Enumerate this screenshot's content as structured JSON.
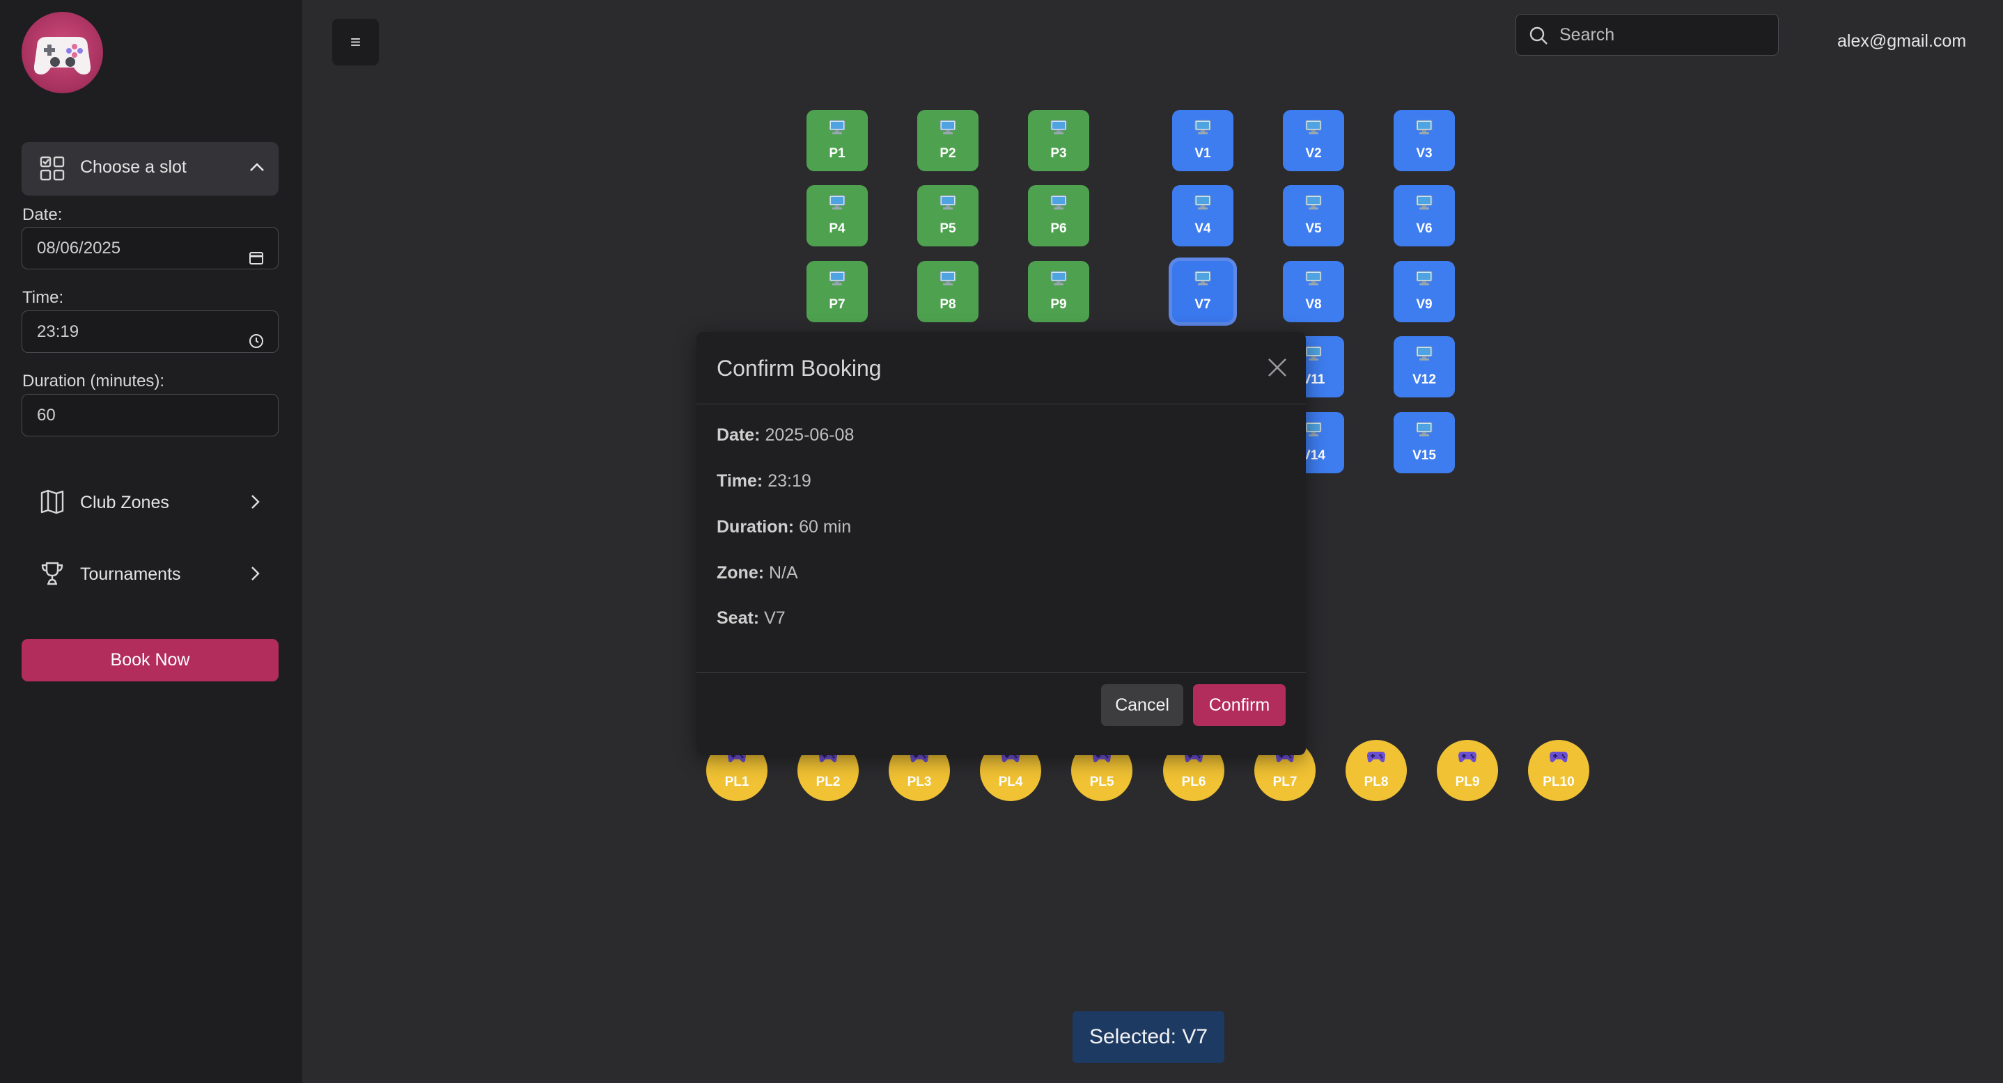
{
  "sidebar": {
    "slot_section": {
      "label": "Choose a slot"
    },
    "date": {
      "label": "Date:",
      "value": "08/06/2025"
    },
    "time": {
      "label": "Time:",
      "value": "23:19"
    },
    "duration": {
      "label": "Duration (minutes):",
      "value": "60"
    },
    "nav": [
      {
        "label": "Club Zones",
        "icon": "map-icon"
      },
      {
        "label": "Tournaments",
        "icon": "trophy-icon"
      }
    ],
    "book_button": "Book Now"
  },
  "topbar": {
    "menu_icon": "≡",
    "search_placeholder": "Search",
    "user_email": "alex@gmail.com"
  },
  "seats": {
    "green": [
      "P1",
      "P2",
      "P3",
      "P4",
      "P5",
      "P6",
      "P7",
      "P8",
      "P9"
    ],
    "blue": [
      "V1",
      "V2",
      "V3",
      "V4",
      "V5",
      "V6",
      "V7",
      "V8",
      "V9",
      "V11",
      "V12",
      "V14",
      "V15"
    ],
    "consoles": [
      "PL1",
      "PL2",
      "PL3",
      "PL4",
      "PL5",
      "PL6",
      "PL7",
      "PL8",
      "PL9",
      "PL10"
    ],
    "selected": "V7"
  },
  "modal": {
    "title": "Confirm Booking",
    "rows": [
      {
        "key": "Date:",
        "value": "2025-06-08"
      },
      {
        "key": "Time:",
        "value": "23:19"
      },
      {
        "key": "Duration:",
        "value": "60 min"
      },
      {
        "key": "Zone:",
        "value": "N/A"
      },
      {
        "key": "Seat:",
        "value": "V7"
      }
    ],
    "cancel": "Cancel",
    "confirm": "Confirm"
  },
  "selected_pill": "Selected: V7",
  "colors": {
    "accent": "#b22d5b",
    "green_seat": "#4ea24f",
    "blue_seat": "#3e7df0",
    "console_seat": "#f1c233"
  }
}
